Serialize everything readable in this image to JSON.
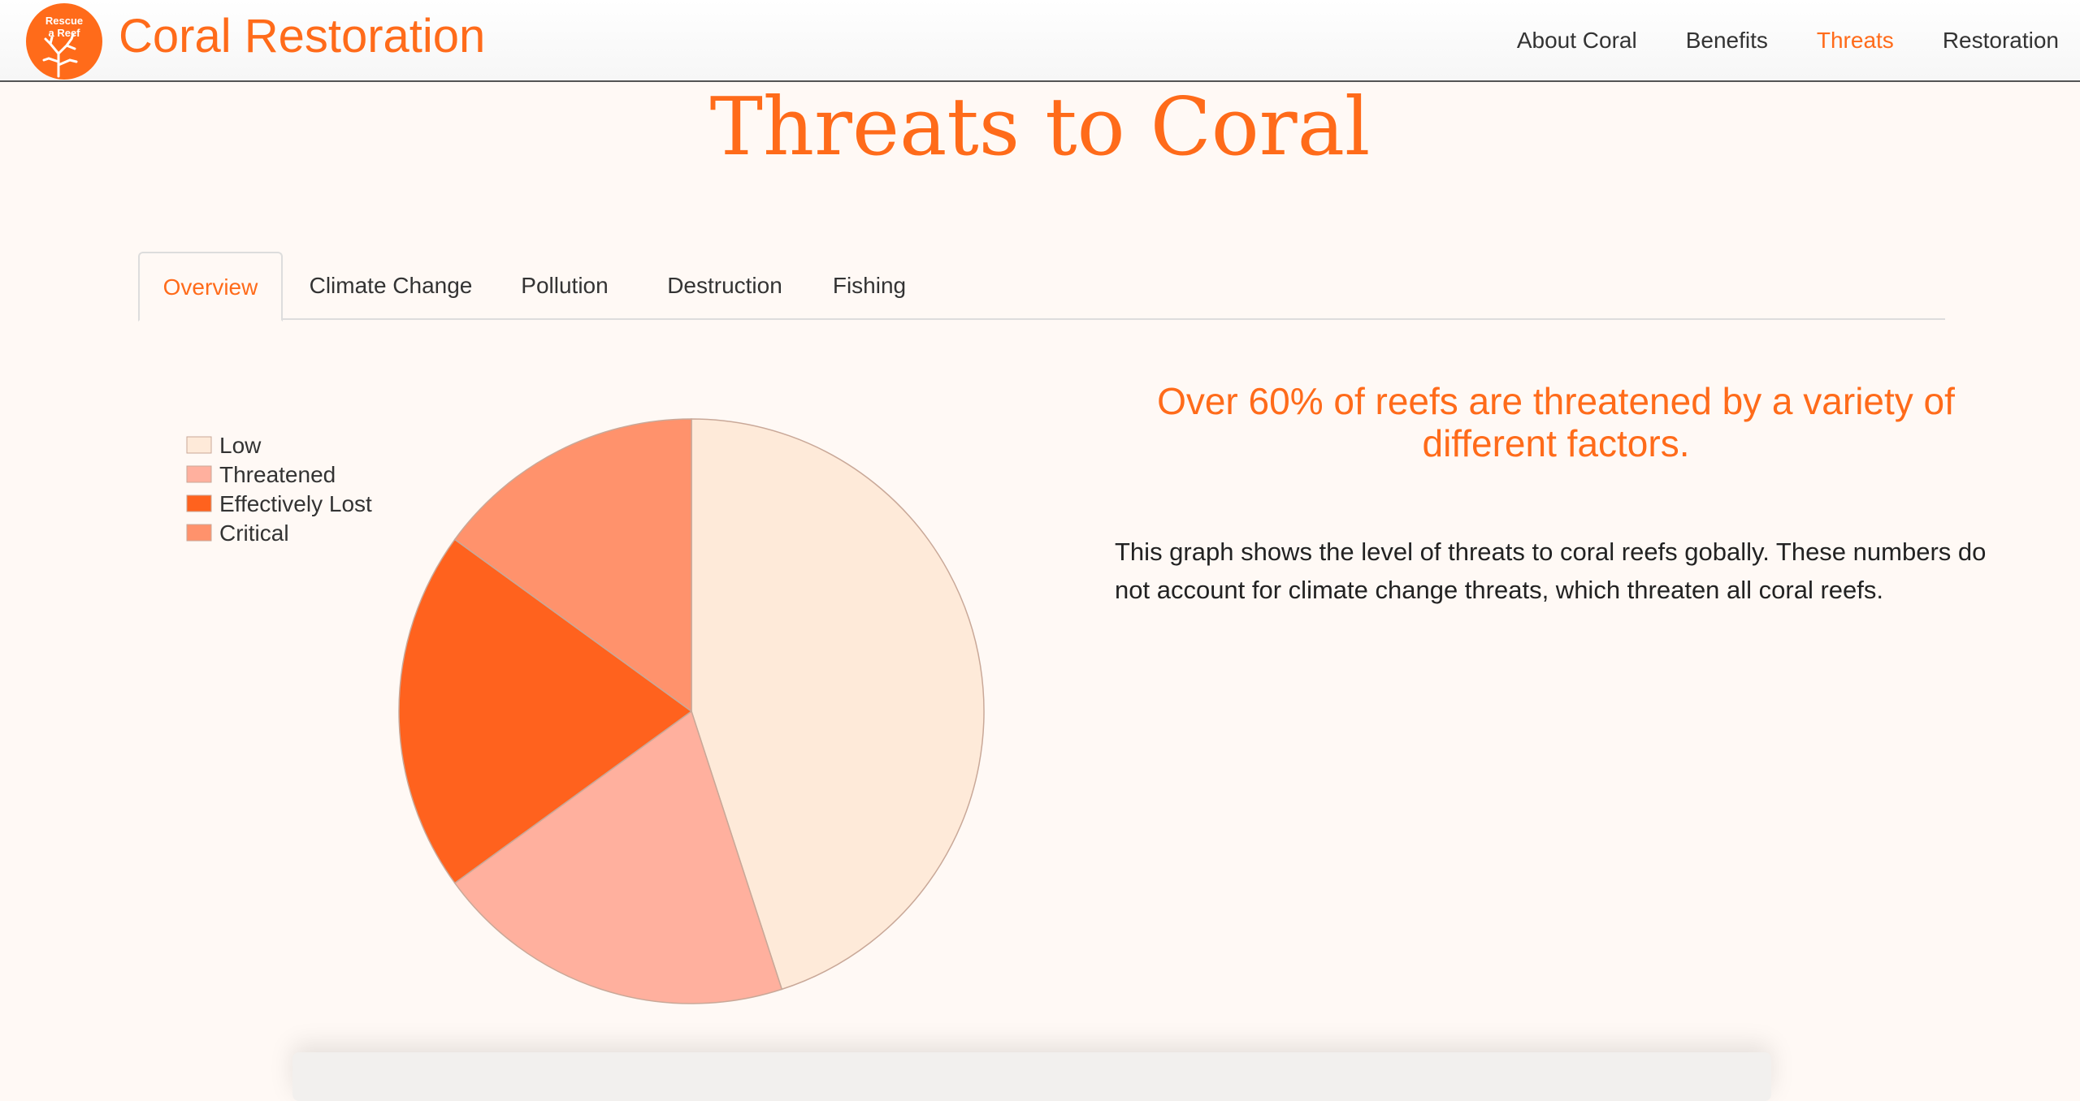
{
  "navbar": {
    "logo_line1": "Rescue",
    "logo_line2": "a Reef",
    "brand": "Coral Restoration",
    "links": [
      {
        "label": "About Coral",
        "active": false
      },
      {
        "label": "Benefits",
        "active": false
      },
      {
        "label": "Threats",
        "active": true
      },
      {
        "label": "Restoration",
        "active": false
      }
    ]
  },
  "page": {
    "title": "Threats to Coral"
  },
  "tabs": [
    {
      "label": "Overview",
      "active": true
    },
    {
      "label": "Climate Change",
      "active": false
    },
    {
      "label": "Pollution",
      "active": false
    },
    {
      "label": "Destruction",
      "active": false
    },
    {
      "label": "Fishing",
      "active": false
    }
  ],
  "overview": {
    "headline": "Over 60% of reefs are threatened by a variety of different factors.",
    "description": "This graph shows the level of threats to coral reefs gobally. These numbers do not account for climate change threats, which threaten all coral reefs."
  },
  "colors": {
    "accent": "#ff6b1a",
    "low": "#feead9",
    "threatened": "#ffb09e",
    "effectively_lost": "#ff621e",
    "critical": "#ff926c"
  },
  "chart_data": {
    "type": "pie",
    "legend_position": "top-left",
    "categories": [
      "Low",
      "Threatened",
      "Effectively Lost",
      "Critical"
    ],
    "values": [
      45,
      20,
      20,
      15
    ],
    "colors": [
      "#feead9",
      "#ffb09e",
      "#ff621e",
      "#ff926c"
    ]
  }
}
